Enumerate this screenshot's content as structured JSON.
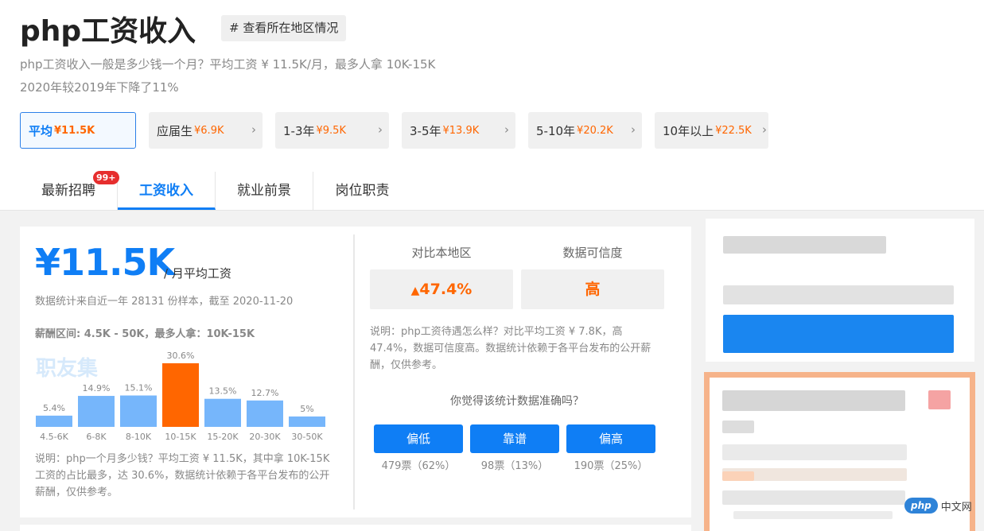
{
  "header": {
    "title": "php工资收入",
    "region_tag": "# 查看所在地区情况",
    "summary_line1": "php工资收入一般是多少钱一个月？平均工资 ¥ 11.5K/月，最多人拿 10K-15K",
    "summary_line2": "2020年较2019年下降了11%"
  },
  "levels": [
    {
      "label": "平均",
      "amount": "¥11.5K",
      "active": true
    },
    {
      "label": "应届生",
      "amount": "¥6.9K"
    },
    {
      "label": "1-3年",
      "amount": "¥9.5K"
    },
    {
      "label": "3-5年",
      "amount": "¥13.9K"
    },
    {
      "label": "5-10年",
      "amount": "¥20.2K"
    },
    {
      "label": "10年以上",
      "amount": "¥22.5K"
    }
  ],
  "tabs": [
    {
      "label": "最新招聘",
      "badge": "99+"
    },
    {
      "label": "工资收入",
      "active": true
    },
    {
      "label": "就业前景"
    },
    {
      "label": "岗位职责"
    }
  ],
  "salary": {
    "average": "¥11.5K",
    "unit": "/ 月平均工资",
    "stat": "数据统计来自近一年 28131 份样本，截至 2020-11-20",
    "range": "薪酬区间: 4.5K - 50K，最多人拿：10K-15K",
    "watermark": "职友集",
    "note": "说明：php一个月多少钱？平均工资 ¥ 11.5K，其中拿 10K-15K 工资的占比最多，达 30.6%，数据统计依赖于各平台发布的公开薪酬，仅供参考。"
  },
  "chart_data": {
    "type": "bar",
    "categories": [
      "4.5-6K",
      "6-8K",
      "8-10K",
      "10-15K",
      "15-20K",
      "20-30K",
      "30-50K"
    ],
    "values": [
      5.4,
      14.9,
      15.1,
      30.6,
      13.5,
      12.7,
      5
    ],
    "value_labels": [
      "5.4%",
      "14.9%",
      "15.1%",
      "30.6%",
      "13.5%",
      "12.7%",
      "5%"
    ],
    "highlight_index": 3,
    "colors": {
      "normal": "#76b6fb",
      "highlight": "#ff6600"
    },
    "title": "",
    "xlabel": "",
    "ylabel": "",
    "ylim": [
      0,
      30.6
    ]
  },
  "compare": {
    "local_label": "对比本地区",
    "local_value": "47.4%",
    "trust_label": "数据可信度",
    "trust_value": "高",
    "note": "说明：php工资待遇怎么样？对比平均工资 ¥ 7.8K，高 47.4%，数据可信度高。数据统计依赖于各平台发布的公开薪酬，仅供参考。",
    "question": "你觉得该统计数据准确吗？",
    "votes": [
      {
        "label": "偏低",
        "count": "479票（62%）"
      },
      {
        "label": "靠谱",
        "count": "98票（13%）"
      },
      {
        "label": "偏高",
        "count": "190票（25%）"
      }
    ]
  },
  "watermark_logo": {
    "php": "php",
    "text": "中文网"
  },
  "colors": {
    "accent": "#0f7ef5",
    "orange": "#ff6600",
    "sidebar_frame": "#f6b38a"
  }
}
